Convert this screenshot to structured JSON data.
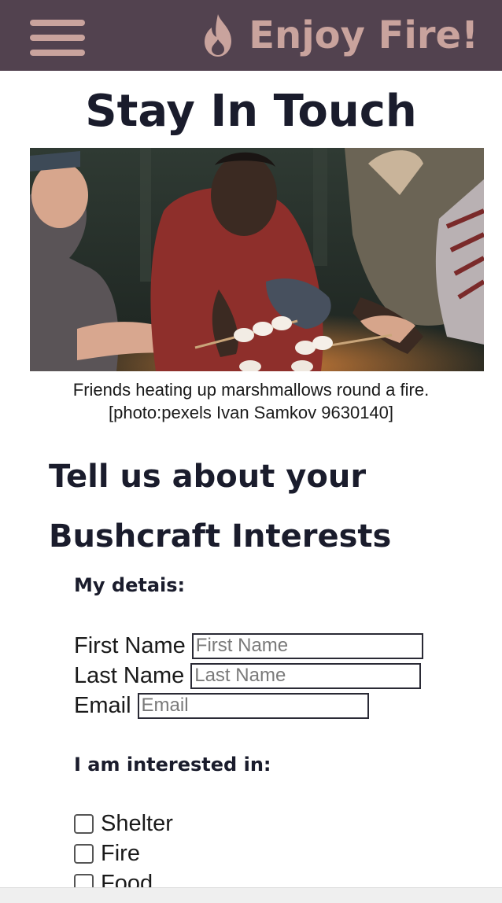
{
  "header": {
    "brand_name": "Enjoy Fire!",
    "brand_icon": "flame-icon",
    "menu_icon": "hamburger-menu-icon",
    "background_color": "#52424f",
    "accent_color": "#c9a39d"
  },
  "page": {
    "title": "Stay In Touch"
  },
  "photo": {
    "caption_line1": "Friends heating up marshmallows round a fire.",
    "caption_line2": "[photo:pexels Ivan Samkov 9630140]"
  },
  "form": {
    "heading_line1": "Tell us about your",
    "heading_line2": "Bushcraft Interests",
    "details_heading": "My detais:",
    "fields": [
      {
        "label": "First Name",
        "placeholder": "First Name",
        "value": ""
      },
      {
        "label": "Last Name",
        "placeholder": "Last Name",
        "value": ""
      },
      {
        "label": "Email",
        "placeholder": "Email",
        "value": ""
      }
    ],
    "interests_heading": "I am interested in:",
    "interests": [
      {
        "label": "Shelter",
        "checked": false
      },
      {
        "label": "Fire",
        "checked": false
      },
      {
        "label": "Food",
        "checked": false
      }
    ]
  }
}
